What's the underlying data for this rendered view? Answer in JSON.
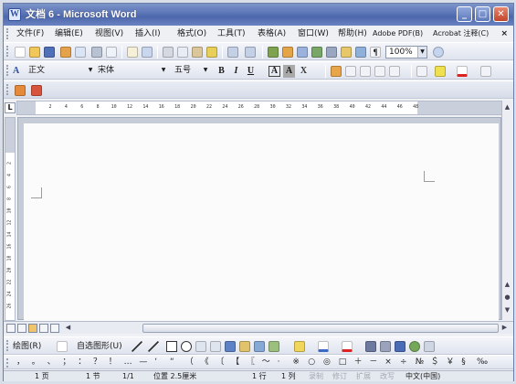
{
  "window": {
    "title": "文档 6 - Microsoft Word",
    "app_icon_letter": "W",
    "minimize": "_",
    "maximize": "□",
    "close": "✕"
  },
  "menu": {
    "items": [
      "文件(F)",
      "编辑(E)",
      "视图(V)",
      "插入(I)",
      "格式(O)",
      "工具(T)",
      "表格(A)",
      "窗口(W)",
      "帮助(H)",
      "Adobe PDF(B)",
      "Acrobat 注释(C)"
    ],
    "close": "×"
  },
  "toolbar_standard": {
    "zoom": "100%",
    "icons": [
      "new-icon",
      "open-icon",
      "save-icon",
      "permission-icon",
      "email-icon",
      "print-icon",
      "print-preview-icon",
      "spelling-icon",
      "research-icon",
      "cut-icon",
      "copy-icon",
      "paste-icon",
      "format-painter-icon",
      "undo-icon",
      "redo-icon",
      "hyperlink-icon",
      "tables-borders-icon",
      "insert-table-icon",
      "insert-excel-icon",
      "columns-icon",
      "drawing-icon",
      "document-map-icon",
      "show-hide-icon",
      "help-icon"
    ]
  },
  "toolbar_format": {
    "style": "正文",
    "font": "宋体",
    "size": "五号",
    "bold": "B",
    "italic": "I",
    "underline": "U",
    "char_border": "A",
    "char_shading": "A",
    "char_scale": "X"
  },
  "ruler": {
    "tab_selector": "L",
    "ticks": [
      "2",
      "4",
      "6",
      "8",
      "10",
      "12",
      "14",
      "16",
      "18",
      "20",
      "22",
      "24",
      "26",
      "28",
      "30",
      "32",
      "34",
      "36",
      "38",
      "40",
      "42",
      "44",
      "46",
      "48"
    ]
  },
  "vertical_ruler": {
    "ticks": [
      "2",
      "4",
      "6",
      "8",
      "10",
      "12",
      "14",
      "16",
      "18",
      "20",
      "22",
      "24",
      "26"
    ]
  },
  "drawing_toolbar": {
    "draw_label": "绘图(R)",
    "autoshapes_label": "自选图形(U)"
  },
  "symbol_toolbar": {
    "symbols": [
      "，",
      "。",
      "、",
      "；",
      "：",
      "？",
      "！",
      "…",
      "—",
      "‘",
      "“",
      "（",
      "《",
      "〔",
      "【",
      "〖",
      "～",
      "·",
      "※",
      "○",
      "◎",
      "□",
      "＋",
      "－",
      "×",
      "÷",
      "№",
      "＄",
      "￥",
      "§",
      "‰"
    ]
  },
  "status_bar": {
    "page": "1 页",
    "section": "1 节",
    "page_of": "1/1",
    "position": "位置 2.5厘米",
    "line": "1 行",
    "column": "1 列",
    "rec": "录制",
    "trk": "修订",
    "ext": "扩展",
    "ovr": "改写",
    "language": "中文(中国)"
  }
}
